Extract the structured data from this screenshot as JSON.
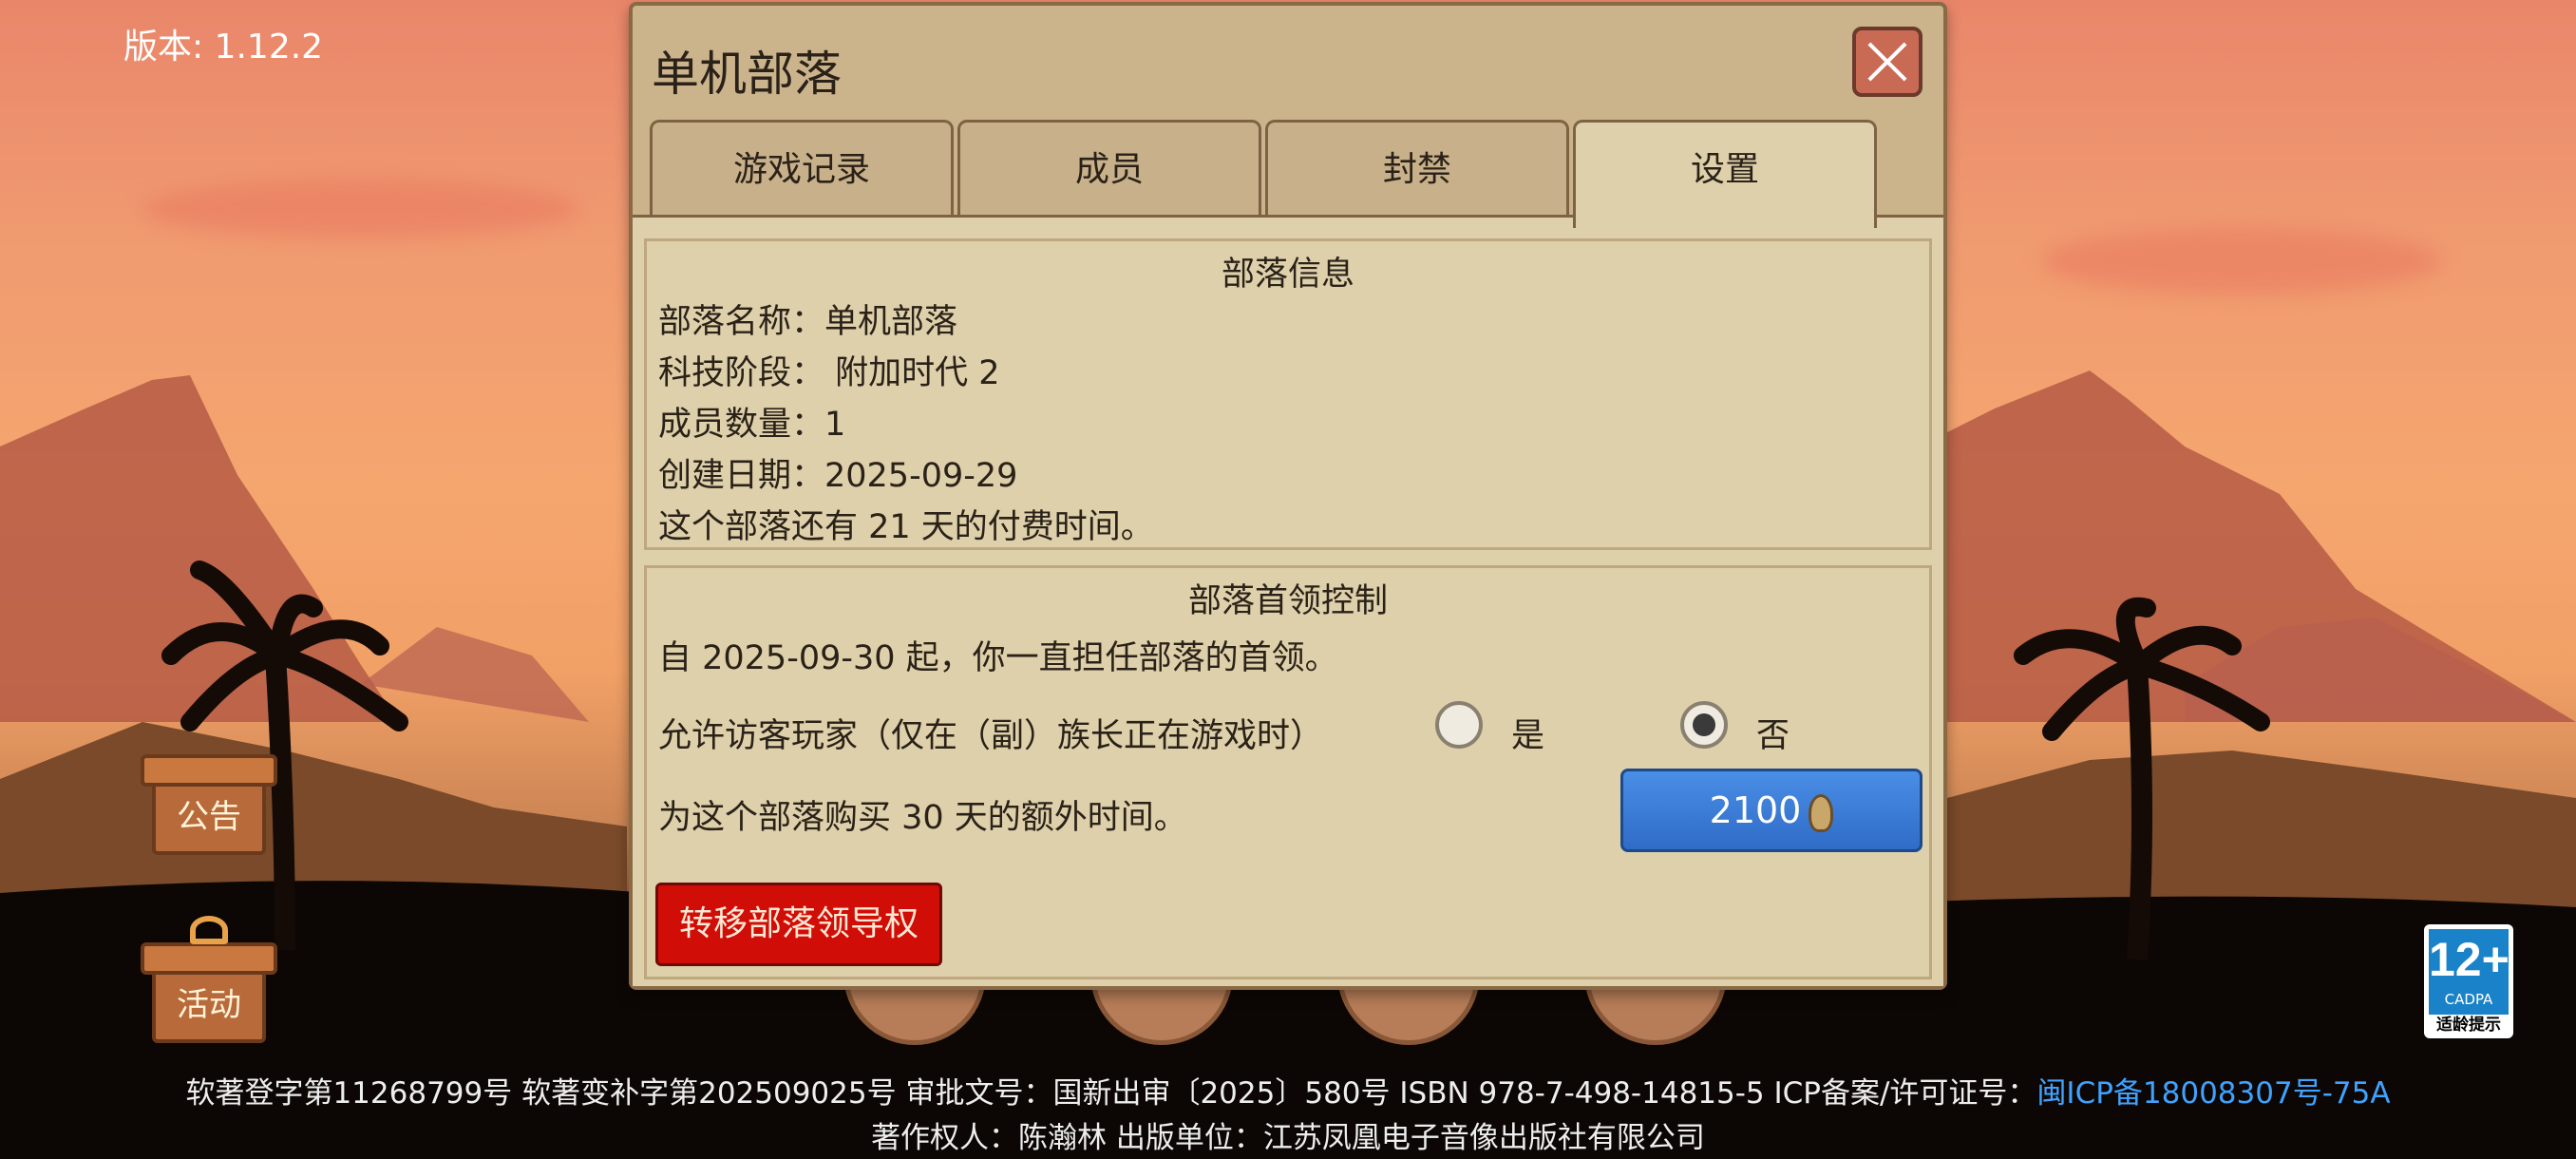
{
  "version_label": "版本: 1.12.2",
  "side_buttons": {
    "notice": "公告",
    "activity": "活动"
  },
  "dialog": {
    "title": "单机部落",
    "tabs": [
      "游戏记录",
      "成员",
      "封禁",
      "设置"
    ],
    "active_tab": "设置",
    "tribe_info": {
      "heading": "部落信息",
      "name": "部落名称：单机部落",
      "tech": "科技阶段： 附加时代 2",
      "members": "成员数量：1",
      "created": "创建日期：2025-09-29",
      "paid_time": "这个部落还有 21 天的付费时间。"
    },
    "leader_control": {
      "heading": "部落首领控制",
      "leader_since": "自 2025-09-30 起，你一直担任部落的首领。",
      "allow_visitors_label": "允许访客玩家（仅在（副）族长正在游戏时）",
      "option_yes": "是",
      "option_no": "否",
      "selected": "否",
      "buy_time_label": "为这个部落购买 30 天的额外时间。",
      "buy_price": "2100",
      "transfer_button": "转移部落领导权"
    }
  },
  "footer": {
    "line1_text": "软著登字第11268799号 软著变补字第202509025号 审批文号：国新出审〔2025〕580号 ISBN 978-7-498-14815-5 ICP备案/许可证号：",
    "icp_link": "闽ICP备18008307号-75A",
    "line2": "著作权人：陈瀚林 出版单位：江苏凤凰电子音像出版社有限公司"
  },
  "age_rating": {
    "age": "12+",
    "org": "CADPA",
    "tip": "适龄提示"
  },
  "colors": {
    "panel": "#ddd0aa",
    "panel_border": "#8a6a45",
    "accent_blue": "#2f6cc7",
    "danger_red": "#d00d06",
    "link": "#3fa2ff"
  },
  "icons": [
    "close-icon",
    "coin-icon",
    "gift-box-icon",
    "notice-board-icon"
  ]
}
